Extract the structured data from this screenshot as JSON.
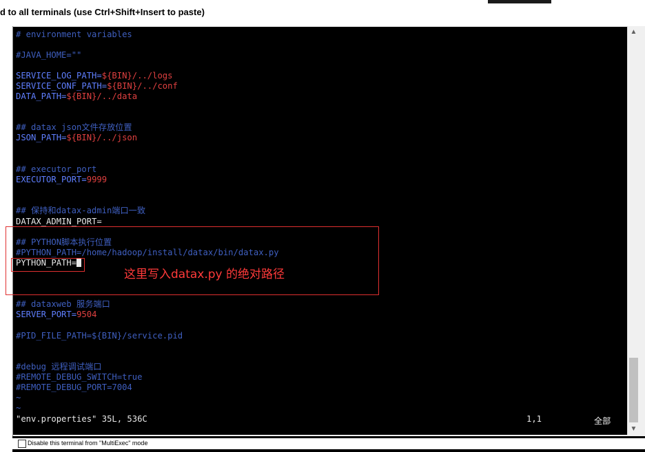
{
  "window": {
    "title": "d to all terminals (use Ctrl+Shift+Insert to paste)"
  },
  "lines": {
    "l1": {
      "a": "# environment variables"
    },
    "l2": {
      "a": "#JAVA_HOME=\"\""
    },
    "l3": {
      "a": "SERVICE_LOG_PATH=",
      "b": "${BIN}/../logs"
    },
    "l4": {
      "a": "SERVICE_CONF_PATH=",
      "b": "${BIN}/../conf"
    },
    "l5": {
      "a": "DATA_PATH=",
      "b": "${BIN}/../data"
    },
    "l6": {
      "a": "## datax json文件存放位置"
    },
    "l7": {
      "a": "JSON_PATH=",
      "b": "${BIN}/../json"
    },
    "l8": {
      "a": "## executor_port"
    },
    "l9": {
      "a": "EXECUTOR_PORT=",
      "b": "9999"
    },
    "l10": {
      "a": "## 保持和datax-admin端口一致"
    },
    "l11": {
      "a": "DATAX_ADMIN_PORT="
    },
    "l12": {
      "a": "## PYTHON脚本执行位置"
    },
    "l13": {
      "a": "#PYTHON_PATH=/home/hadoop/install/datax/bin/datax.py"
    },
    "l14": {
      "a": "PYTHON_PATH="
    },
    "l15": {
      "a": "## dataxweb 服务端口"
    },
    "l16": {
      "a": "SERVER_PORT=",
      "b": "9504"
    },
    "l17": {
      "a": "#PID_FILE_PATH=${BIN}/service.pid"
    },
    "l18": {
      "a": "#debug 远程调试端口"
    },
    "l19": {
      "a": "#REMOTE_DEBUG_SWITCH=true"
    },
    "l20": {
      "a": "#REMOTE_DEBUG_PORT=7004"
    },
    "tilde": "~"
  },
  "status": {
    "file": "\"env.properties\" 35L, 536C",
    "position": "1,1",
    "scroll": "全部"
  },
  "annotation": "这里写入datax.py 的绝对路径",
  "footer": {
    "checkbox_label": "Disable this terminal from \"MultiExec\" mode"
  },
  "icons": {
    "scroll_up": "▲",
    "scroll_down": "▼"
  },
  "colors": {
    "background": "#000000",
    "comment": "#3f5fc0",
    "key": "#5f7fff",
    "value": "#e04040",
    "annotation": "#ff3a3a"
  }
}
